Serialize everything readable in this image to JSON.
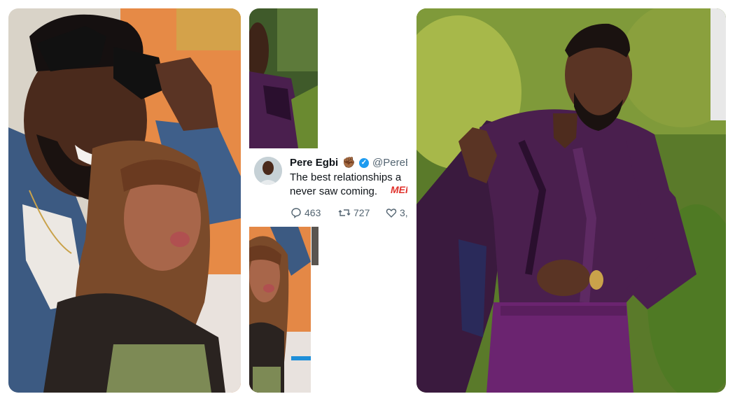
{
  "tweet": {
    "display_name": "Pere Egbi",
    "name_emoji": "✊🏾",
    "verified_glyph": "✓",
    "handle": "@PereE",
    "text_line_1": "The best relationships a",
    "text_line_2": "never saw coming.",
    "text_emoji": "MEF",
    "replies": "463",
    "reposts": "727",
    "likes": "3,",
    "reply_icon": "reply-icon",
    "repost_icon": "repost-icon",
    "like_icon": "heart-icon"
  },
  "colors": {
    "shirt_purple": "#4a1f4e",
    "pants_purple": "#6b2470",
    "foliage_green": "#6f8f2e",
    "wall_orange": "#e8914a",
    "verified_blue": "#1d9bf0"
  }
}
